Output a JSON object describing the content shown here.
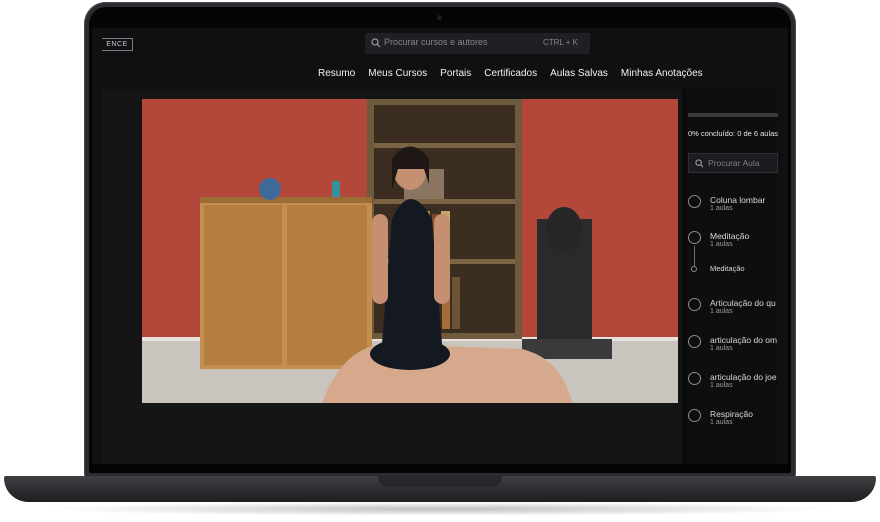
{
  "header": {
    "logo_text": "ENCE",
    "search_placeholder": "Procurar cursos e autores",
    "search_shortcut": "CTRL + K"
  },
  "nav": {
    "items": [
      "Resumo",
      "Meus Cursos",
      "Portais",
      "Certificados",
      "Aulas Salvas",
      "Minhas Anotações"
    ]
  },
  "sidebar": {
    "progress_percent": 0,
    "progress_text": "0% concluído: 0 de 6 aulas",
    "search_placeholder": "Procurar Aula",
    "lessons": [
      {
        "title": "Coluna lombar",
        "subtitle": "1 aulas"
      },
      {
        "title": "Meditação",
        "subtitle": "1 aulas",
        "sub_item": "Meditação"
      },
      {
        "title": "Articulação do qu",
        "subtitle": "1 aulas"
      },
      {
        "title": "articulação do om",
        "subtitle": "1 aulas"
      },
      {
        "title": "articulação do joe",
        "subtitle": "1 aulas"
      },
      {
        "title": "Respiração",
        "subtitle": "1 aulas"
      }
    ]
  },
  "colors": {
    "background": "#0f1012",
    "wall": "#b3483a",
    "text": "#f1f1f1"
  }
}
